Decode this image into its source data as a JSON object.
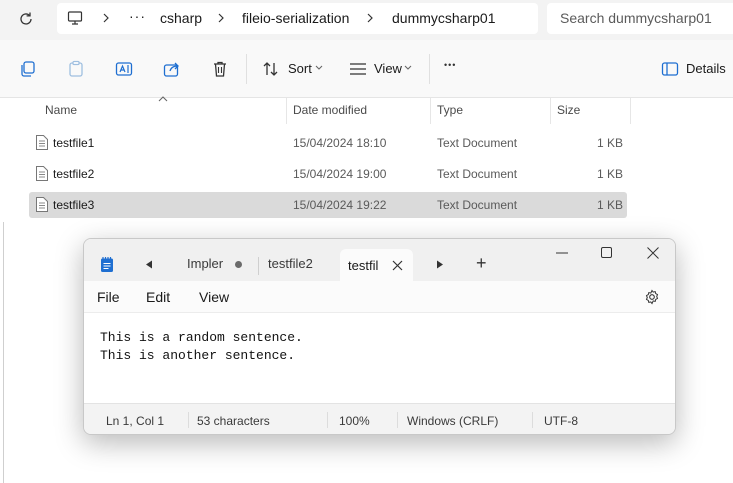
{
  "explorer": {
    "breadcrumb": {
      "overflow": "···",
      "items": [
        "csharp",
        "fileio-serialization",
        "dummycsharp01"
      ]
    },
    "search_placeholder": "Search dummycsharp01",
    "toolbar": {
      "sort_label": "Sort",
      "view_label": "View",
      "more_label": "•••",
      "details_label": "Details"
    },
    "columns": [
      "Name",
      "Date modified",
      "Type",
      "Size"
    ],
    "files": [
      {
        "name": "testfile1",
        "modified": "15/04/2024 18:10",
        "type": "Text Document",
        "size": "1 KB",
        "selected": false
      },
      {
        "name": "testfile2",
        "modified": "15/04/2024 19:00",
        "type": "Text Document",
        "size": "1 KB",
        "selected": false
      },
      {
        "name": "testfile3",
        "modified": "15/04/2024 19:22",
        "type": "Text Document",
        "size": "1 KB",
        "selected": true
      }
    ]
  },
  "notepad": {
    "tabs": [
      {
        "label": "Impler",
        "unsaved": true
      },
      {
        "label": "testfile2",
        "unsaved": false
      },
      {
        "label": "testfil",
        "active": true
      }
    ],
    "new_tab": "+",
    "menu": [
      "File",
      "Edit",
      "View"
    ],
    "content_lines": [
      "This is a random sentence.",
      "This is another sentence."
    ],
    "status": {
      "position": "Ln 1, Col 1",
      "characters": "53 characters",
      "zoom": "100%",
      "line_ending": "Windows (CRLF)",
      "encoding": "UTF-8"
    }
  },
  "colors": {
    "selected_row": "#dadada",
    "notepad_icon": "#1f6fd1"
  }
}
